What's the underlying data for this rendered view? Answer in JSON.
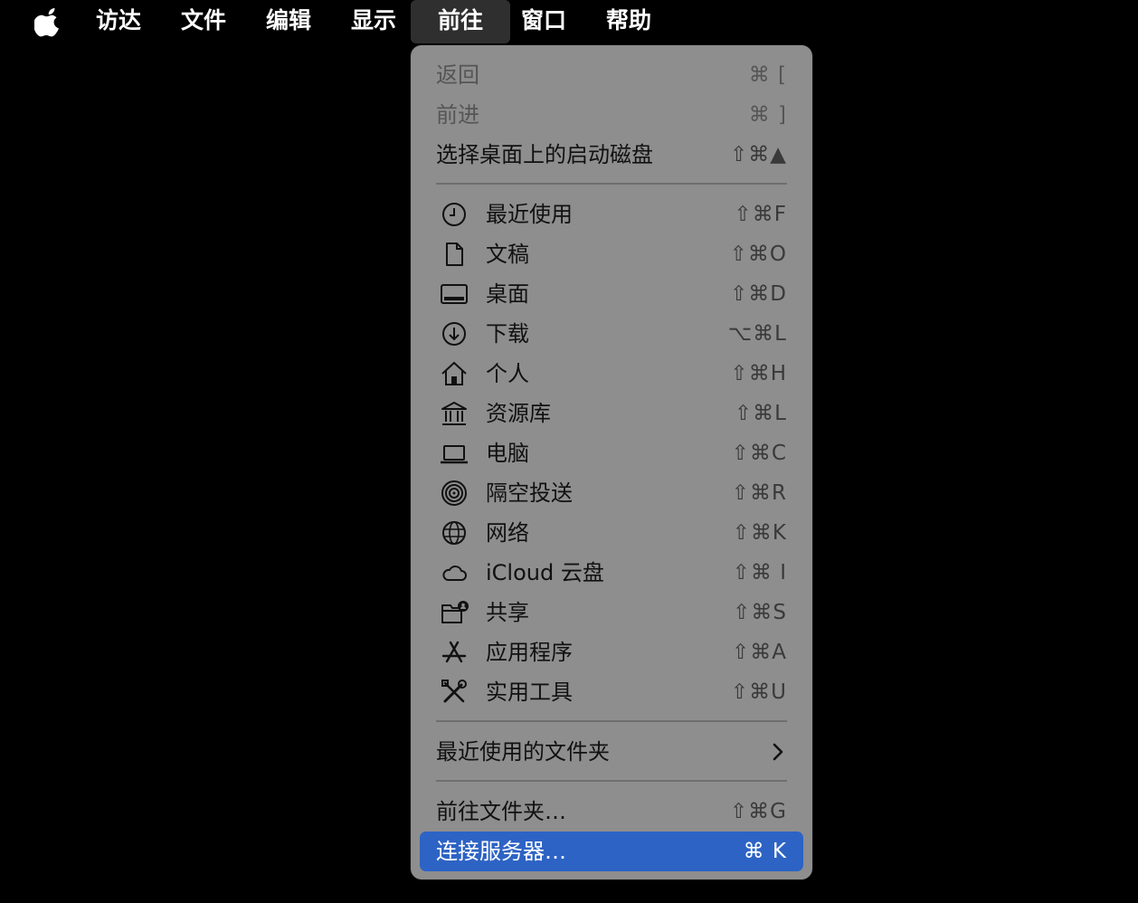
{
  "menubar": {
    "apple_icon": "apple-logo-icon",
    "items": [
      "访达",
      "文件",
      "编辑",
      "显示",
      "前往",
      "窗口",
      "帮助"
    ],
    "active": "前往"
  },
  "menu": {
    "top_items": [
      {
        "label": "返回",
        "shortcut": "⌘ [",
        "enabled": false
      },
      {
        "label": "前进",
        "shortcut": "⌘ ]",
        "enabled": false
      },
      {
        "label": "选择桌面上的启动磁盘",
        "shortcut": "⇧⌘▲",
        "enabled": true
      }
    ],
    "places": [
      {
        "label": "最近使用",
        "shortcut": "⇧⌘F",
        "icon": "clock-icon"
      },
      {
        "label": "文稿",
        "shortcut": "⇧⌘O",
        "icon": "document-icon"
      },
      {
        "label": "桌面",
        "shortcut": "⇧⌘D",
        "icon": "desktop-icon"
      },
      {
        "label": "下载",
        "shortcut": "⌥⌘L",
        "icon": "download-icon"
      },
      {
        "label": "个人",
        "shortcut": "⇧⌘H",
        "icon": "home-icon"
      },
      {
        "label": "资源库",
        "shortcut": "⇧⌘L",
        "icon": "library-icon"
      },
      {
        "label": "电脑",
        "shortcut": "⇧⌘C",
        "icon": "laptop-icon"
      },
      {
        "label": "隔空投送",
        "shortcut": "⇧⌘R",
        "icon": "airdrop-icon"
      },
      {
        "label": "网络",
        "shortcut": "⇧⌘K",
        "icon": "globe-icon"
      },
      {
        "label": "iCloud 云盘",
        "shortcut": "⇧⌘ I",
        "icon": "cloud-icon"
      },
      {
        "label": "共享",
        "shortcut": "⇧⌘S",
        "icon": "shared-folder-icon"
      },
      {
        "label": "应用程序",
        "shortcut": "⇧⌘A",
        "icon": "app-store-icon"
      },
      {
        "label": "实用工具",
        "shortcut": "⇧⌘U",
        "icon": "tools-icon"
      }
    ],
    "recent_folders": {
      "label": "最近使用的文件夹",
      "icon": "chevron-right-icon"
    },
    "goto_folder": {
      "label": "前往文件夹…",
      "shortcut": "⇧⌘G"
    },
    "connect_server": {
      "label": "连接服务器…",
      "shortcut": "⌘ K",
      "highlighted": true
    }
  },
  "colors": {
    "menu_bg": "#8e8e8e",
    "highlight": "#2d63c4",
    "menubar_bg": "#000000"
  }
}
